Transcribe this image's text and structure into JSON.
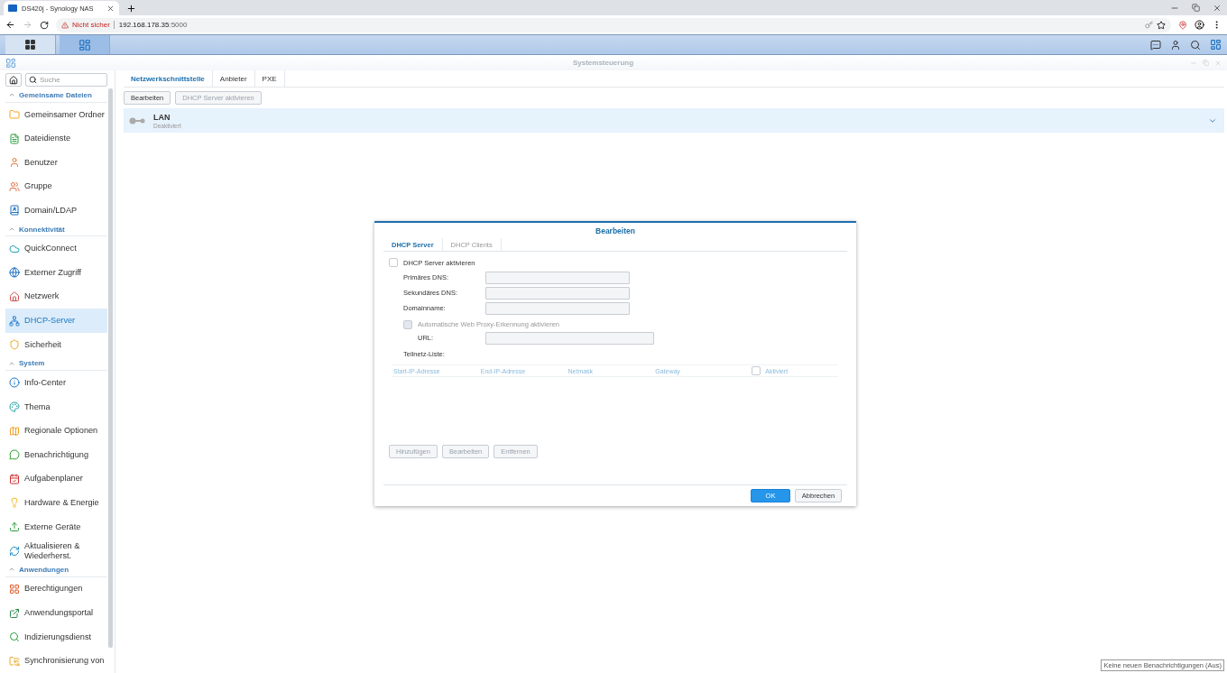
{
  "browser": {
    "tab_title": "DS420j - Synology NAS",
    "security": "Nicht sicher",
    "url_host": "192.168.178.35",
    "url_port": ":5000"
  },
  "window": {
    "title": "Systemsteuerung"
  },
  "sidebar": {
    "search": {
      "placeholder": "Suche"
    },
    "sections": [
      {
        "title": "Gemeinsame Dateien",
        "expanded": true,
        "items": [
          {
            "label": "Gemeinsamer Ordner",
            "selected": false
          },
          {
            "label": "Dateidienste",
            "selected": false
          },
          {
            "label": "Benutzer",
            "selected": false
          },
          {
            "label": "Gruppe",
            "selected": false
          },
          {
            "label": "Domain/LDAP",
            "selected": false
          }
        ]
      },
      {
        "title": "Konnektivität",
        "expanded": true,
        "items": [
          {
            "label": "QuickConnect",
            "selected": false
          },
          {
            "label": "Externer Zugriff",
            "selected": false
          },
          {
            "label": "Netzwerk",
            "selected": false
          },
          {
            "label": "DHCP-Server",
            "selected": true
          },
          {
            "label": "Sicherheit",
            "selected": false
          }
        ]
      },
      {
        "title": "System",
        "expanded": true,
        "items": [
          {
            "label": "Info-Center",
            "selected": false
          },
          {
            "label": "Thema",
            "selected": false
          },
          {
            "label": "Regionale Optionen",
            "selected": false
          },
          {
            "label": "Benachrichtigung",
            "selected": false
          },
          {
            "label": "Aufgabenplaner",
            "selected": false
          },
          {
            "label": "Hardware & Energie",
            "selected": false
          },
          {
            "label": "Externe Geräte",
            "selected": false
          },
          {
            "label": "Aktualisieren & Wiederherst.",
            "selected": false
          }
        ]
      },
      {
        "title": "Anwendungen",
        "expanded": true,
        "items": [
          {
            "label": "Berechtigungen",
            "selected": false
          },
          {
            "label": "Anwendungsportal",
            "selected": false
          },
          {
            "label": "Indizierungsdienst",
            "selected": false
          },
          {
            "label": "Synchronisierung von",
            "selected": false
          }
        ]
      }
    ]
  },
  "tabs": [
    {
      "label": "Netzwerkschnittstelle",
      "selected": true
    },
    {
      "label": "Anbieter",
      "selected": false
    },
    {
      "label": "PXE",
      "selected": false
    }
  ],
  "toolbar": [
    {
      "label": "Bearbeiten",
      "disabled": false
    },
    {
      "label": "DHCP Server aktivieren",
      "disabled": true
    }
  ],
  "interfaces": [
    {
      "name": "LAN",
      "status": "Deaktiviert",
      "expanded": false
    }
  ],
  "dialog": {
    "title": "Bearbeiten",
    "tabs": [
      {
        "label": "DHCP Server",
        "selected": true
      },
      {
        "label": "DHCP Clients",
        "selected": false
      }
    ],
    "enable": {
      "label": "DHCP Server aktivieren",
      "checked": false,
      "disabled": false
    },
    "fields": [
      {
        "label": "Primäres DNS:",
        "disabled": true
      },
      {
        "label": "Sekundäres DNS:",
        "disabled": true
      },
      {
        "label": "Domainname:",
        "disabled": true
      }
    ],
    "proxy": {
      "label": "Automatische Web Proxy-Erkennung aktivieren",
      "checked": false,
      "disabled": true
    },
    "url": {
      "label": "URL:",
      "disabled": true
    },
    "subnet_label": "Teilnetz-Liste:",
    "columns": [
      {
        "label": "Start-IP-Adresse"
      },
      {
        "label": "End-IP-Adresse"
      },
      {
        "label": "Netmask"
      },
      {
        "label": "Gateway"
      },
      {
        "label": "Aktiviert",
        "checked": false
      }
    ],
    "table_buttons": [
      {
        "label": "Hinzufügen",
        "disabled": true
      },
      {
        "label": "Bearbeiten",
        "disabled": true
      },
      {
        "label": "Entfernen",
        "disabled": true
      }
    ],
    "buttons": [
      {
        "label": "OK",
        "kind": "primary"
      },
      {
        "label": "Abbrechen",
        "kind": "secondary"
      }
    ]
  },
  "tooltip": "Keine neuen Benachrichtigungen (Aus)"
}
